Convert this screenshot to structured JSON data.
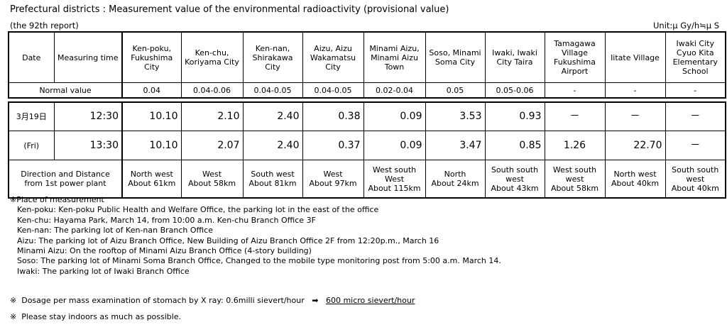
{
  "title": "Prefectural districts : Measurement value of the environmental radioactivity (provisional value)",
  "report": "(the 92th report)",
  "unit": "Unit:μ Gy/h≒μ S",
  "table": {
    "header": {
      "date": "Date",
      "time": "Measuring time",
      "locations": [
        [
          "Ken-poku,",
          "Fukushima",
          "City"
        ],
        [
          "Ken-chu,",
          "Koriyama City"
        ],
        [
          "Ken-nan,",
          "Shirakawa",
          "City"
        ],
        [
          "Aizu, Aizu",
          "Wakamatsu",
          "City"
        ],
        [
          "Minami Aizu,",
          "Minami Aizu",
          "Town"
        ],
        [
          "Soso, Minami",
          "Soma City"
        ],
        [
          "Iwaki, Iwaki",
          "City Taira"
        ],
        [
          "Tamagawa",
          "Village",
          "Fukushima",
          "Airport"
        ],
        [
          "Iitate Village"
        ],
        [
          "Iwaki City",
          "Cyuo Kita",
          "Elementary",
          "School"
        ]
      ]
    },
    "normal": {
      "label": "Normal value",
      "values": [
        "0.04",
        "0.04-0.06",
        "0.04-0.05",
        "0.04-0.05",
        "0.02-0.04",
        "0.05",
        "0.05-0.06",
        "-",
        "-",
        "-"
      ]
    },
    "rows": [
      {
        "date": "3月19日",
        "time": "12:30",
        "values": [
          "10.10",
          "2.10",
          "2.40",
          "0.38",
          "0.09",
          "3.53",
          "0.93",
          "－",
          "－",
          "－"
        ]
      },
      {
        "date": "(Fri)",
        "time": "13:30",
        "values": [
          "10.10",
          "2.07",
          "2.40",
          "0.37",
          "0.09",
          "3.47",
          "0.85",
          "1.26",
          "22.70",
          "－"
        ]
      }
    ],
    "direction": {
      "label": [
        "Direction and Distance",
        "from 1st power plant"
      ],
      "values": [
        [
          "North west",
          "About 61km"
        ],
        [
          "West",
          "About 58km"
        ],
        [
          "South west",
          "About 81km"
        ],
        [
          "West",
          "About 97km"
        ],
        [
          "West south",
          "West",
          "About 115km"
        ],
        [
          "North",
          "About 24km"
        ],
        [
          "South south",
          "west",
          "About 43km"
        ],
        [
          "West south",
          "west",
          "About 58km"
        ],
        [
          "North west",
          "About 40km"
        ],
        [
          "South south",
          "west",
          "About 40km"
        ]
      ]
    }
  },
  "notes": {
    "heading": "※Place of measurement",
    "items": [
      "Ken-poku: Ken-poku Public Health and Welfare Office, the parking lot in the east of the office",
      "Ken-chu: Hayama Park, March 14,  from 10:00 a.m. Ken-chu Branch Office 3F",
      "Ken-nan: The parking lot of Ken-nan Branch Office",
      "Aizu: The parking lot of Aizu Branch Office, New Building of Aizu Branch Office 2F from 12:20p.m., March 16",
      "Minami Aizu: On the rooftop of Minami Aizu Branch Office (4-story building)",
      "Soso: The parking lot of Minami Soma Branch Office, Changed to the mobile type monitoring post from 5:00 a.m. March 14.",
      "Iwaki: The parking lot of Iwaki Branch Office"
    ]
  },
  "footnotes": {
    "xray_mark": "※",
    "xray_text": "Dosage per mass examination of stomach by X ray:  0.6milli sievert/hour",
    "xray_arrow": "➡",
    "xray_value": "600 micro sievert/hour",
    "indoors_mark": "※",
    "indoors_text": "Please stay indoors as much as possible."
  }
}
